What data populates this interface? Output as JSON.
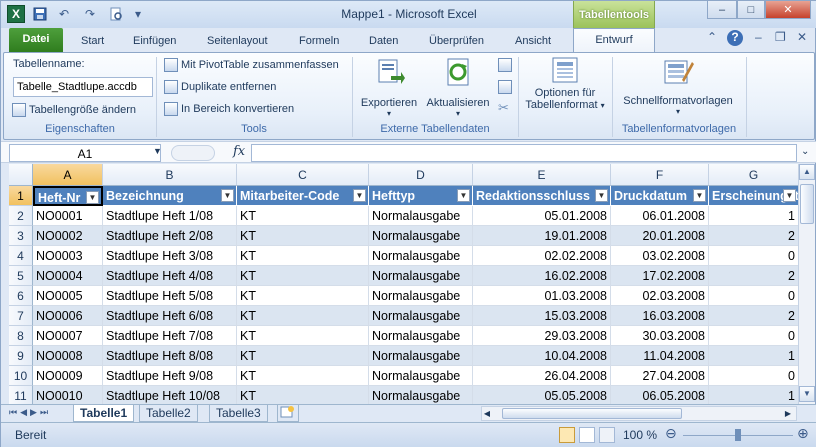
{
  "window": {
    "title": "Mappe1  -  Microsoft Excel",
    "context_tab": "Tabellentools",
    "controls": {
      "minimize": "–",
      "maximize": "□",
      "close": "✕"
    }
  },
  "qat": {
    "app_icon": "X",
    "save_icon": "save-icon",
    "undo_icon": "undo-icon",
    "redo_icon": "redo-icon"
  },
  "tabs": [
    "Datei",
    "Start",
    "Einfügen",
    "Seitenlayout",
    "Formeln",
    "Daten",
    "Überprüfen",
    "Ansicht",
    "Entwurf"
  ],
  "ribbon": {
    "eigenschaften": {
      "label": "Eigenschaften",
      "name_label": "Tabellenname:",
      "name_value": "Tabelle_Stadtlupe.accdb",
      "resize": "Tabellengröße ändern"
    },
    "tools": {
      "label": "Tools",
      "pivot": "Mit PivotTable zusammenfassen",
      "dupes": "Duplikate entfernen",
      "convert": "In Bereich konvertieren"
    },
    "extern": {
      "label": "Externe Tabellendaten",
      "export": "Exportieren",
      "refresh": "Aktualisieren"
    },
    "options": {
      "label1": "Optionen für",
      "label2": "Tabellenformat"
    },
    "styles": {
      "label": "Tabellenformatvorlagen",
      "quick": "Schnellformatvorlagen"
    }
  },
  "formula_bar": {
    "name_box": "A1",
    "fx": "fx",
    "value": ""
  },
  "columns": [
    "A",
    "B",
    "C",
    "D",
    "E",
    "F",
    "G"
  ],
  "header_row": [
    "Heft-Nr",
    "Bezeichnung",
    "Mitarbeiter-Code",
    "Hefttyp",
    "Redaktionsschluss",
    "Druckdatum",
    "Erscheinungst"
  ],
  "rows": [
    {
      "n": "2",
      "cells": [
        "NO0001",
        "Stadtlupe Heft 1/08",
        "KT",
        "Normalausgabe",
        "05.01.2008",
        "06.01.2008",
        "1"
      ]
    },
    {
      "n": "3",
      "cells": [
        "NO0002",
        "Stadtlupe Heft 2/08",
        "KT",
        "Normalausgabe",
        "19.01.2008",
        "20.01.2008",
        "2"
      ]
    },
    {
      "n": "4",
      "cells": [
        "NO0003",
        "Stadtlupe Heft 3/08",
        "KT",
        "Normalausgabe",
        "02.02.2008",
        "03.02.2008",
        "0"
      ]
    },
    {
      "n": "5",
      "cells": [
        "NO0004",
        "Stadtlupe Heft 4/08",
        "KT",
        "Normalausgabe",
        "16.02.2008",
        "17.02.2008",
        "2"
      ]
    },
    {
      "n": "6",
      "cells": [
        "NO0005",
        "Stadtlupe Heft 5/08",
        "KT",
        "Normalausgabe",
        "01.03.2008",
        "02.03.2008",
        "0"
      ]
    },
    {
      "n": "7",
      "cells": [
        "NO0006",
        "Stadtlupe Heft 6/08",
        "KT",
        "Normalausgabe",
        "15.03.2008",
        "16.03.2008",
        "2"
      ]
    },
    {
      "n": "8",
      "cells": [
        "NO0007",
        "Stadtlupe Heft 7/08",
        "KT",
        "Normalausgabe",
        "29.03.2008",
        "30.03.2008",
        "0"
      ]
    },
    {
      "n": "9",
      "cells": [
        "NO0008",
        "Stadtlupe Heft 8/08",
        "KT",
        "Normalausgabe",
        "10.04.2008",
        "11.04.2008",
        "1"
      ]
    },
    {
      "n": "10",
      "cells": [
        "NO0009",
        "Stadtlupe Heft 9/08",
        "KT",
        "Normalausgabe",
        "26.04.2008",
        "27.04.2008",
        "0"
      ]
    },
    {
      "n": "11",
      "cells": [
        "NO0010",
        "Stadtlupe Heft 10/08",
        "KT",
        "Normalausgabe",
        "05.05.2008",
        "06.05.2008",
        "1"
      ]
    }
  ],
  "sheets": [
    "Tabelle1",
    "Tabelle2",
    "Tabelle3"
  ],
  "status": {
    "ready": "Bereit",
    "zoom": "100 %"
  }
}
